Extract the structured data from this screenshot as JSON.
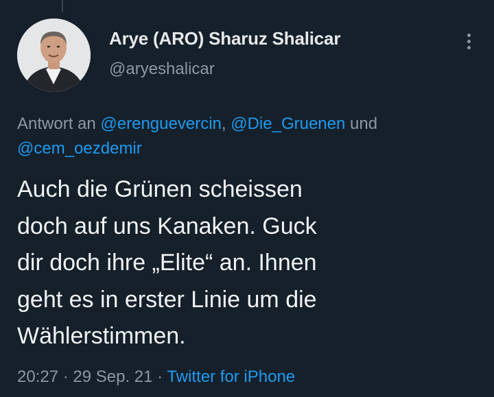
{
  "author": {
    "display_name": "Arye (ARO) Sharuz Shalicar",
    "handle": "@aryeshalicar"
  },
  "reply": {
    "prefix": "Antwort an ",
    "mentions": [
      "@erenguevercin",
      "@Die_Gruenen",
      "@cem_oezdemir"
    ],
    "separator_1": ", ",
    "separator_2": " und "
  },
  "tweet": {
    "lines": [
      "Auch die Grünen scheissen",
      "doch auf uns Kanaken. Guck",
      "dir doch ihre „Elite“ an. Ihnen",
      "geht es in erster Linie um die",
      "Wählerstimmen."
    ]
  },
  "meta": {
    "time": "20:27",
    "dot": " · ",
    "date": "29 Sep. 21",
    "source": "Twitter for iPhone"
  },
  "icons": {
    "more": "more-vertical-icon"
  },
  "colors": {
    "background": "#15202b",
    "link": "#1d9bf0",
    "secondary_text": "#8b98a5",
    "primary_text": "#e7e9ea"
  }
}
